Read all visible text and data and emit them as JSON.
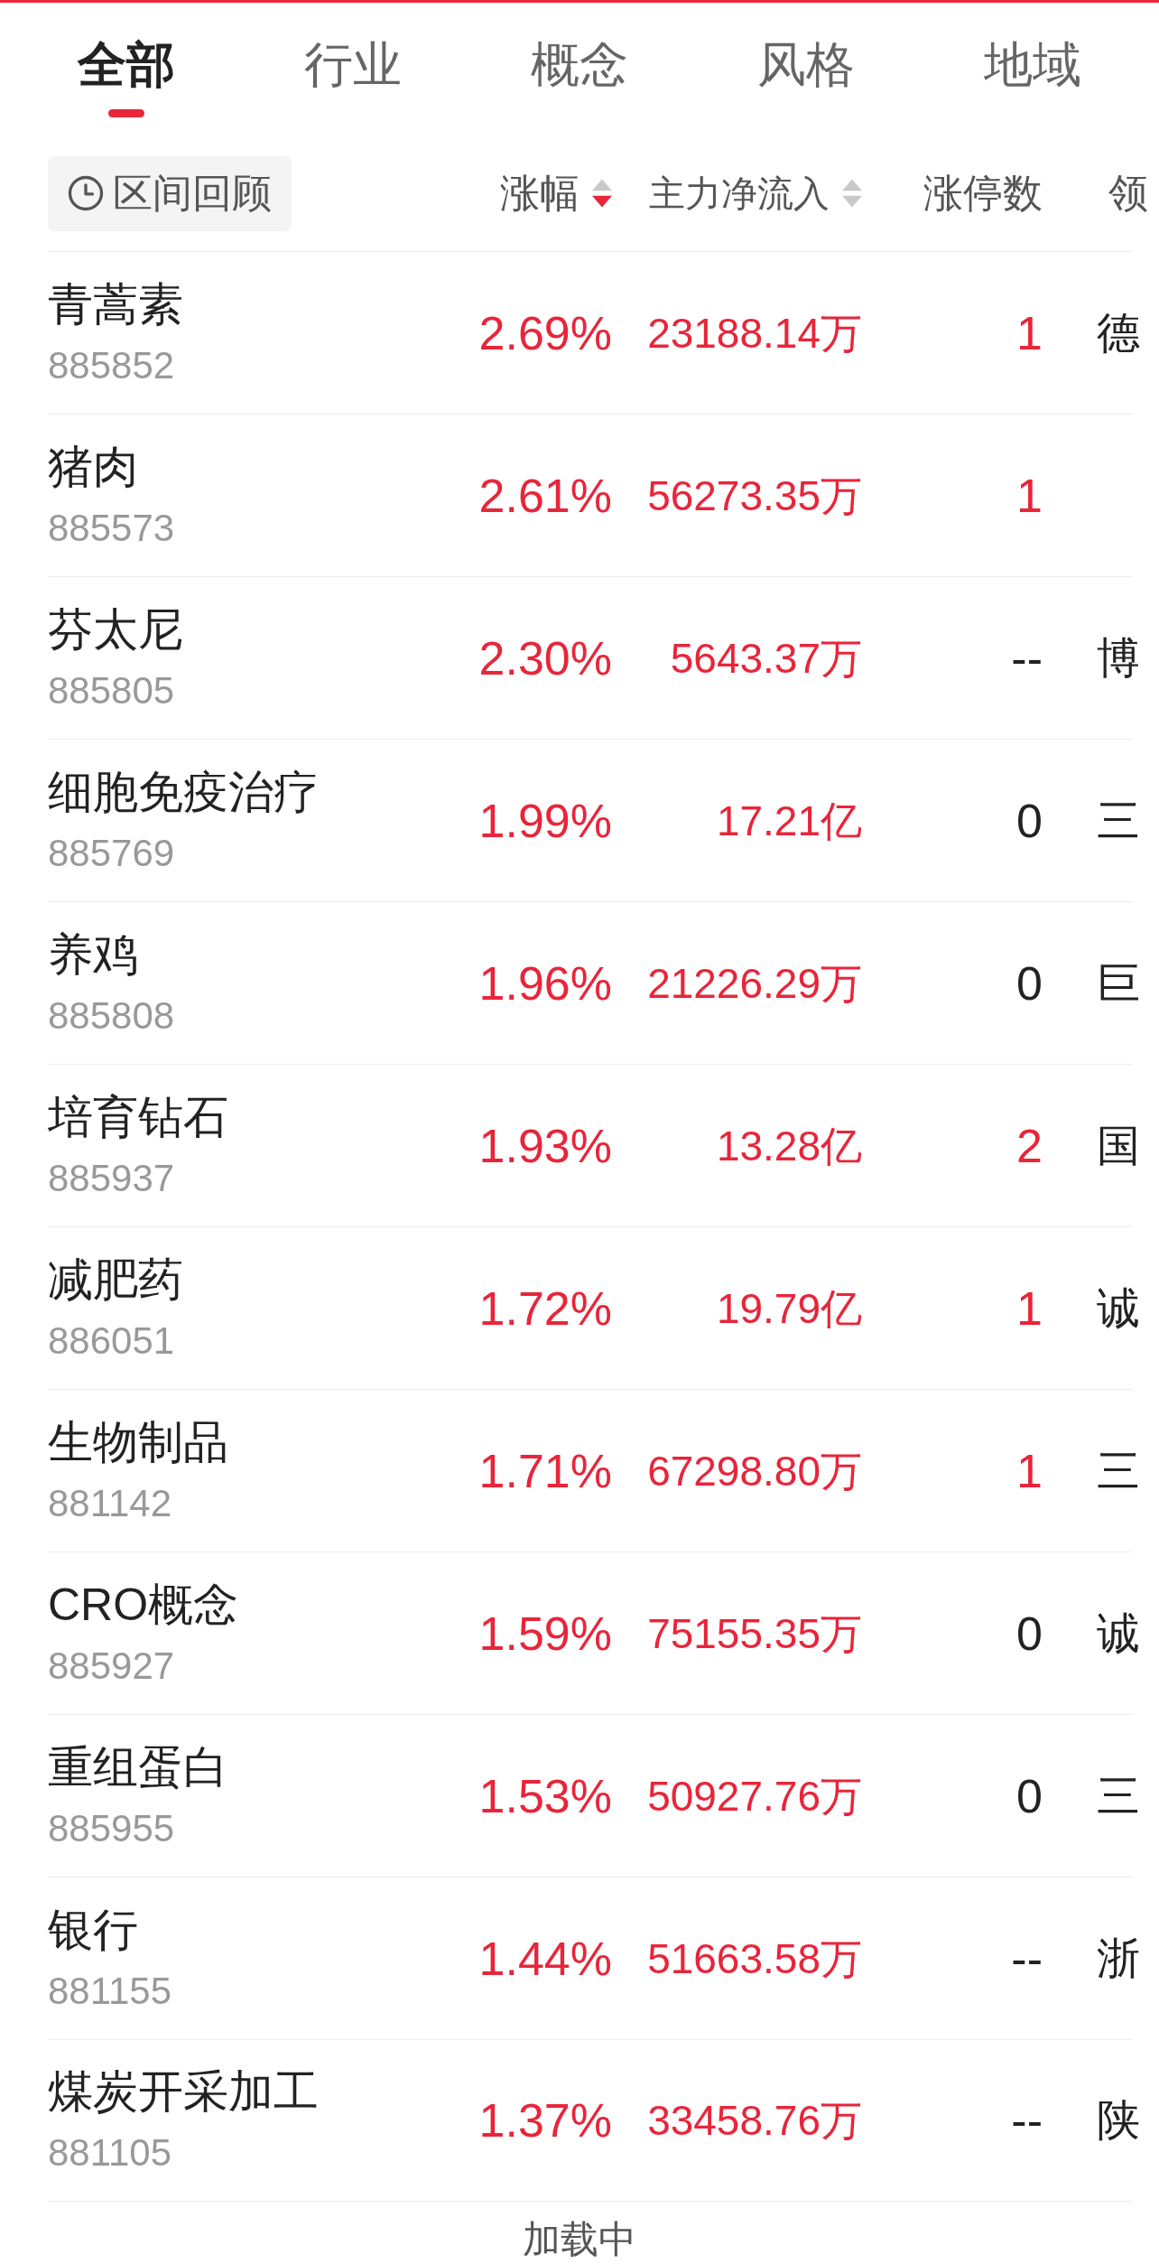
{
  "tabs": [
    {
      "label": "全部",
      "selected": true
    },
    {
      "label": "行业",
      "selected": false
    },
    {
      "label": "概念",
      "selected": false
    },
    {
      "label": "风格",
      "selected": false
    },
    {
      "label": "地域",
      "selected": false
    }
  ],
  "toolbar": {
    "range_button": "区间回顾"
  },
  "columns": [
    {
      "label": "涨幅",
      "sortable": true,
      "sort_descending": true
    },
    {
      "label": "主力净流入",
      "sortable": true,
      "sort_descending": false
    },
    {
      "label": "涨停数",
      "sortable": false
    },
    {
      "label": "领",
      "sortable": false
    }
  ],
  "rows": [
    {
      "name": "青蒿素",
      "code": "885852",
      "change": "2.69%",
      "net_inflow": "23188.14万",
      "rising": true,
      "limit_up_count": "1",
      "limit_up_highlight": true,
      "leader": "德"
    },
    {
      "name": "猪肉",
      "code": "885573",
      "change": "2.61%",
      "net_inflow": "56273.35万",
      "rising": true,
      "limit_up_count": "1",
      "limit_up_highlight": true
    },
    {
      "name": "芬太尼",
      "code": "885805",
      "change": "2.30%",
      "net_inflow": "5643.37万",
      "rising": true,
      "limit_up_count": "--",
      "limit_up_highlight": false,
      "leader": "博"
    },
    {
      "name": "细胞免疫治疗",
      "code": "885769",
      "change": "1.99%",
      "net_inflow": "17.21亿",
      "rising": true,
      "limit_up_count": "0",
      "limit_up_highlight": false,
      "leader": "三"
    },
    {
      "name": "养鸡",
      "code": "885808",
      "change": "1.96%",
      "net_inflow": "21226.29万",
      "rising": true,
      "limit_up_count": "0",
      "limit_up_highlight": false,
      "leader": "巨"
    },
    {
      "name": "培育钻石",
      "code": "885937",
      "change": "1.93%",
      "net_inflow": "13.28亿",
      "rising": true,
      "limit_up_count": "2",
      "limit_up_highlight": true,
      "leader": "国"
    },
    {
      "name": "减肥药",
      "code": "886051",
      "change": "1.72%",
      "net_inflow": "19.79亿",
      "rising": true,
      "limit_up_count": "1",
      "limit_up_highlight": true,
      "leader": "诚"
    },
    {
      "name": "生物制品",
      "code": "881142",
      "change": "1.71%",
      "net_inflow": "67298.80万",
      "rising": true,
      "limit_up_count": "1",
      "limit_up_highlight": true,
      "leader": "三"
    },
    {
      "name": "CRO概念",
      "code": "885927",
      "change": "1.59%",
      "net_inflow": "75155.35万",
      "rising": true,
      "limit_up_count": "0",
      "limit_up_highlight": false,
      "leader": "诚"
    },
    {
      "name": "重组蛋白",
      "code": "885955",
      "change": "1.53%",
      "net_inflow": "50927.76万",
      "rising": true,
      "limit_up_count": "0",
      "limit_up_highlight": false,
      "leader": "三"
    },
    {
      "name": "银行",
      "code": "881155",
      "change": "1.44%",
      "net_inflow": "51663.58万",
      "rising": true,
      "limit_up_count": "--",
      "limit_up_highlight": false,
      "leader": "浙"
    },
    {
      "name": "煤炭开采加工",
      "code": "881105",
      "change": "1.37%",
      "net_inflow": "33458.76万",
      "rising": true,
      "limit_up_count": "--",
      "limit_up_highlight": false,
      "leader": "陕"
    }
  ],
  "footer": {
    "status": "加载中"
  }
}
